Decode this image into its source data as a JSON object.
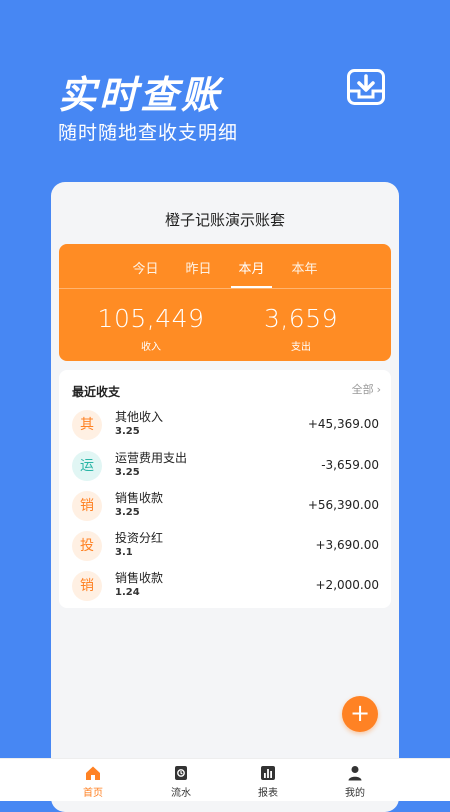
{
  "hero": {
    "title": "实时查账",
    "subtitle": "随时随地查收支明细",
    "icon": "download-box-icon"
  },
  "book": {
    "title": "橙子记账演示账套"
  },
  "summary": {
    "tabs": [
      {
        "label": "今日",
        "active": false
      },
      {
        "label": "昨日",
        "active": false
      },
      {
        "label": "本月",
        "active": true
      },
      {
        "label": "本年",
        "active": false
      }
    ],
    "income": {
      "value": "105,449",
      "label": "收入"
    },
    "expense": {
      "value": "3,659",
      "label": "支出"
    }
  },
  "recent": {
    "title": "最近收支",
    "see_all": "全部",
    "items": [
      {
        "avatar": "其",
        "name": "其他收入",
        "date": "3.25",
        "amount": "+45,369.00",
        "avatar_bg": "#fff0e3",
        "avatar_color": "#ff8224"
      },
      {
        "avatar": "运",
        "name": "运营费用支出",
        "date": "3.25",
        "amount": "-3,659.00",
        "avatar_bg": "#e1f6f4",
        "avatar_color": "#2ab5a6"
      },
      {
        "avatar": "销",
        "name": "销售收款",
        "date": "3.25",
        "amount": "+56,390.00",
        "avatar_bg": "#fff0e3",
        "avatar_color": "#ff8224"
      },
      {
        "avatar": "投",
        "name": "投资分红",
        "date": "3.1",
        "amount": "+3,690.00",
        "avatar_bg": "#fff0e3",
        "avatar_color": "#ff8224"
      },
      {
        "avatar": "销",
        "name": "销售收款",
        "date": "1.24",
        "amount": "+2,000.00",
        "avatar_bg": "#fff0e3",
        "avatar_color": "#ff8224"
      }
    ]
  },
  "fab": {
    "label": "+",
    "icon": "plus-icon"
  },
  "tabbar": {
    "items": [
      {
        "label": "首页",
        "icon": "home-icon",
        "active": true
      },
      {
        "label": "流水",
        "icon": "ledger-icon",
        "active": false
      },
      {
        "label": "报表",
        "icon": "chart-icon",
        "active": false
      },
      {
        "label": "我的",
        "icon": "user-icon",
        "active": false
      }
    ]
  },
  "colors": {
    "background": "#4787f3",
    "accent": "#ff8224",
    "summary_bg": "#ff8c24"
  }
}
